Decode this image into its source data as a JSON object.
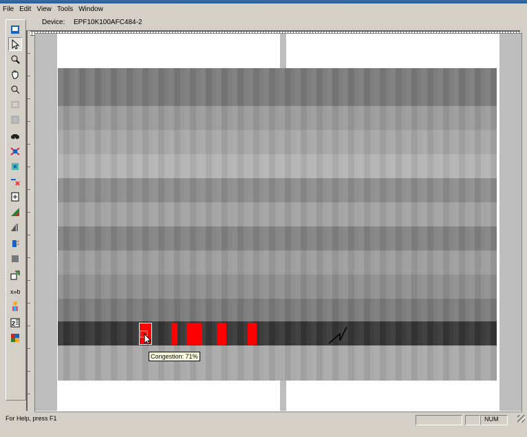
{
  "menu": [
    "File",
    "Edit",
    "View",
    "Tools",
    "Window"
  ],
  "device": {
    "label": "Device:",
    "value": "EPF10K100AFC484-2"
  },
  "tooltip": {
    "text": "Congestion: 71%"
  },
  "status": {
    "help": "For Help, press F1",
    "num": "NUM"
  },
  "toolbar_icons": [
    "floorplan-icon",
    "pointer-icon",
    "zoom-icon",
    "hand-icon",
    "zoom-region-icon",
    "disabled-icon",
    "disabled-grid-icon",
    "find-icon",
    "assign-icon",
    "lock-icon",
    "delete-assign-icon",
    "properties-icon",
    "graph-icon",
    "route-icon",
    "chip-icon",
    "block-icon",
    "congestion-icon",
    "ab-icon",
    "person-icon",
    "legend-icon",
    "grid-map-icon"
  ],
  "colors": {
    "congestion": "#ff0000",
    "dark_row": "#363636"
  }
}
